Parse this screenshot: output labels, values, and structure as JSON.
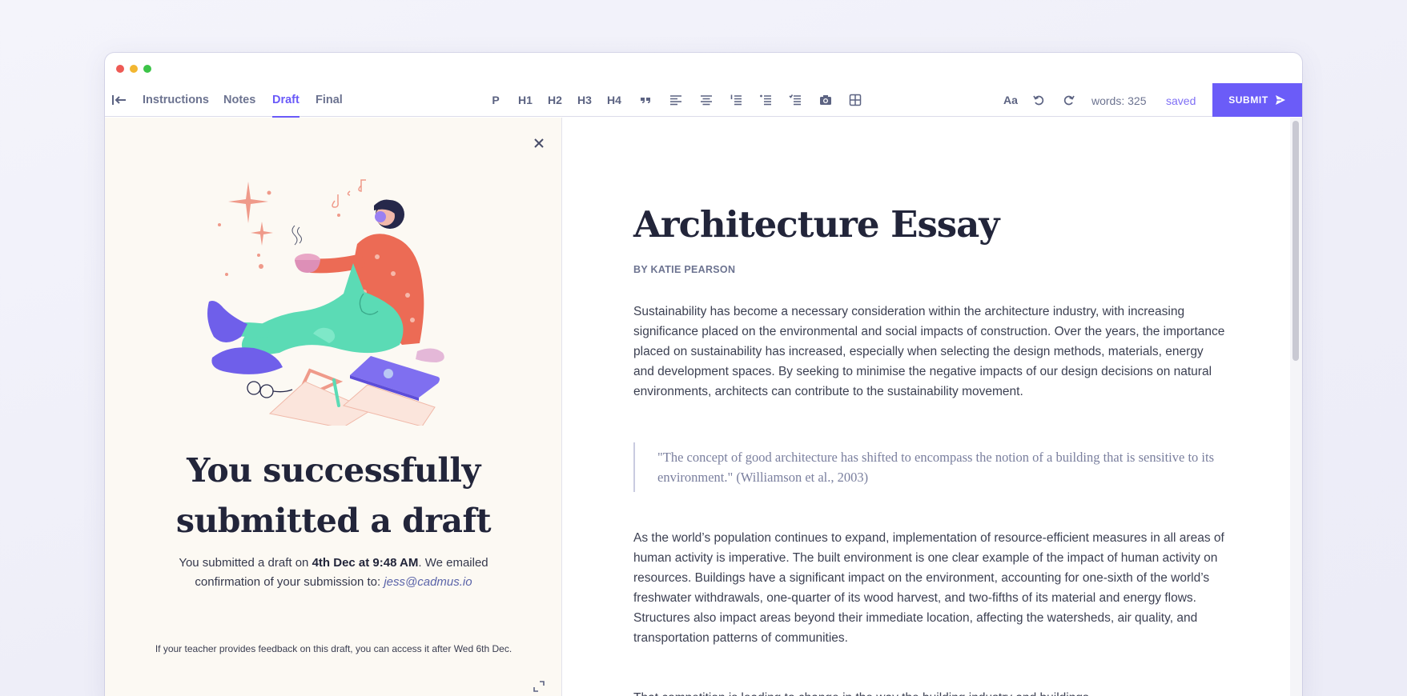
{
  "tabs": [
    {
      "label": "Instructions"
    },
    {
      "label": "Notes"
    },
    {
      "label": "Draft"
    },
    {
      "label": "Final"
    }
  ],
  "format_tools": {
    "p": "P",
    "h1": "H1",
    "h2": "H2",
    "h3": "H3",
    "h4": "H4",
    "font_size": "Aa"
  },
  "status": {
    "words": "words: 325",
    "saved": "saved"
  },
  "submit_label": "SUBMIT",
  "success": {
    "title_line1": "You successfully",
    "title_line2": "submitted a draft",
    "text_before": "You submitted a draft on ",
    "date": "4th Dec at 9:48 AM",
    "text_after": ". We emailed confirmation of your submission to: ",
    "email": "jess@cadmus.io",
    "feedback_note": "If your teacher provides feedback on this draft, you can access it after Wed 6th Dec."
  },
  "essay": {
    "title": "Architecture Essay",
    "byline": "BY KATIE PEARSON",
    "paragraph1": "Sustainability has become a necessary consideration within the architecture industry, with increasing significance placed on the environmental and social impacts of construction. Over the years, the importance placed on sustainability has increased, especially when selecting the design methods, materials, energy and development spaces. By seeking to minimise the negative impacts of our design decisions on natural environments, architects can contribute to the sustainability movement.",
    "quote": "\"The concept of good architecture has shifted to encompass the notion of a building that is sensitive to its environment.\" (Williamson et al., 2003)",
    "paragraph2": "As the world’s population continues to expand, implementation of resource-efficient measures in all areas of human activity is imperative. The built environment is one clear example of the impact of human activity on resources. Buildings have a significant impact on the environment, accounting for one-sixth of the world’s freshwater withdrawals, one-quarter of its wood harvest, and two-fifths of its material and energy flows. Structures also impact areas beyond their immediate location, affecting the watersheds, air quality, and transportation patterns of communities.",
    "paragraph3": "That competition is leading to change in the way the building industry and buildings"
  },
  "colors": {
    "accent": "#6b5cf8",
    "panel_bg": "#fcf9f3"
  }
}
